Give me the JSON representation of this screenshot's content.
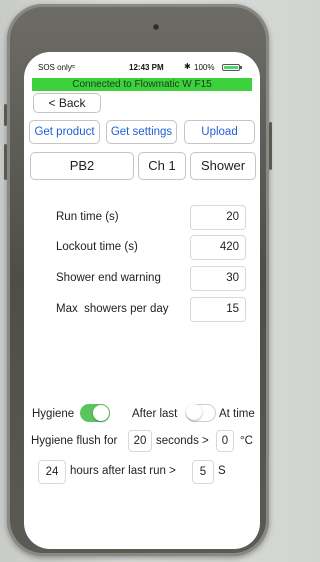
{
  "status_bar": {
    "carrier": "SOS only",
    "time": "12:43 PM",
    "battery": "100%",
    "battery_level": 1.0
  },
  "connection_banner": "Connected to Flowmatic W F15",
  "back_button": "< Back",
  "toolbar": {
    "get_product": "Get product",
    "get_settings": "Get settings",
    "upload": "Upload"
  },
  "selectors": {
    "product": "PB2",
    "channel": "Ch 1",
    "mode": "Shower"
  },
  "settings": [
    {
      "label": "Run time (s)",
      "value": "20"
    },
    {
      "label": "Lockout time (s)",
      "value": "420"
    },
    {
      "label": "Shower end warning",
      "value": "30"
    },
    {
      "label": "Max  showers per day",
      "value": "15"
    }
  ],
  "hygiene": {
    "label": "Hygiene",
    "enabled": true,
    "after_last_label": "After last",
    "at_time_label": "At time",
    "at_time_selected": false,
    "flush_label": "Hygiene flush for",
    "flush_seconds": "20",
    "seconds_label": "seconds >",
    "temperature": "0",
    "temperature_unit": "°C",
    "hours": "24",
    "hours_label": "hours after last run >",
    "s_value": "5",
    "s_label": "S"
  },
  "colors": {
    "banner": "#3ed13e",
    "accent": "#1f5fd6",
    "toggle_on": "#5cc45c"
  }
}
